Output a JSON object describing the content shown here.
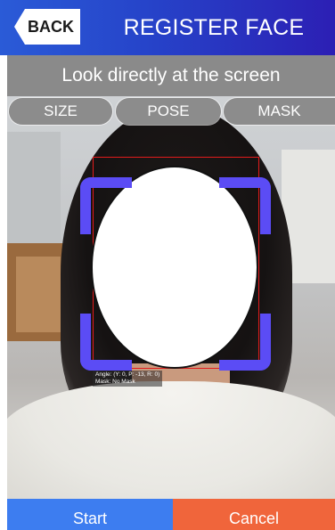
{
  "header": {
    "back_label": "BACK",
    "title": "REGISTER FACE",
    "gradient_colors": [
      "#2a5bd7",
      "#2c1fb4"
    ]
  },
  "instruction": "Look directly at the screen",
  "tabs": [
    {
      "label": "SIZE"
    },
    {
      "label": "POSE"
    },
    {
      "label": "MASK"
    }
  ],
  "camera": {
    "angle_text": "Angle: (Y: 0, P: -13, R: 0)",
    "mask_text": "Mask: No Mask",
    "frame_color": "#e31b1b",
    "guide_color": "#5b4cf5"
  },
  "footer": {
    "start_label": "Start",
    "cancel_label": "Cancel",
    "start_color": "#3d7df0",
    "cancel_color": "#f0653b"
  }
}
